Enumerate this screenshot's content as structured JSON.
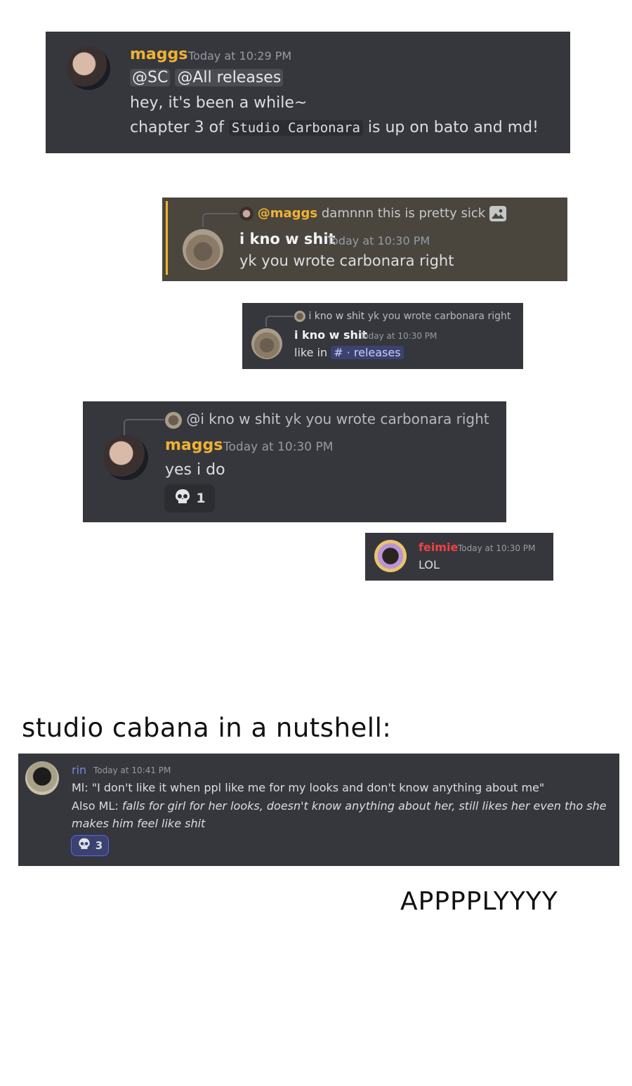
{
  "msg1": {
    "username": "maggs",
    "timestamp": "Today at 10:29 PM",
    "mention_sc": "@SC",
    "mention_all": "@All releases",
    "line1": "hey, it's been a while~",
    "line2_prefix": "chapter 3 of",
    "line2_code": "Studio Carbonara",
    "line2_suffix": "is up on bato and md!"
  },
  "msg2": {
    "reply_user": "@maggs",
    "reply_text": "damnnn this is pretty sick",
    "username": "i kno w shit",
    "timestamp": "Today at 10:30 PM",
    "text": "yk you wrote carbonara right"
  },
  "msg3": {
    "reply_user": "i kno w shit",
    "reply_text": "yk you wrote carbonara right",
    "username": "i kno w shit",
    "timestamp": "Today at 10:30 PM",
    "text_prefix": "like in",
    "channel_hash": "#",
    "channel_name": "· releases"
  },
  "msg4": {
    "reply_user": "@i kno w shit",
    "reply_text": "yk you wrote carbonara right",
    "username": "maggs",
    "timestamp": "Today at 10:30 PM",
    "text": "yes i do",
    "reaction_count": "1"
  },
  "msg5": {
    "username": "feimie",
    "timestamp": "Today at 10:30 PM",
    "text": "LOL"
  },
  "caption": "studio cabana in a nutshell:",
  "msg6": {
    "username": "rin",
    "timestamp": "Today at 10:41 PM",
    "line1": "Ml: \"I don't like it when ppl like me for my looks and don't know anything about me\"",
    "line2_prefix": "Also ML:",
    "line2_italic": "falls for girl for her looks, doesn't know anything about her, still likes her even tho she",
    "line3_italic": "makes him feel like shit",
    "reaction_count": "3"
  },
  "footer": "APPPPLYYYY",
  "colors": {
    "maggs": "#f0b232",
    "feimie": "#f23f43",
    "rin": "#7289da",
    "card_bg": "#36373d",
    "highlight_bg": "#4a463d",
    "highlight_bar": "#f0b232"
  }
}
